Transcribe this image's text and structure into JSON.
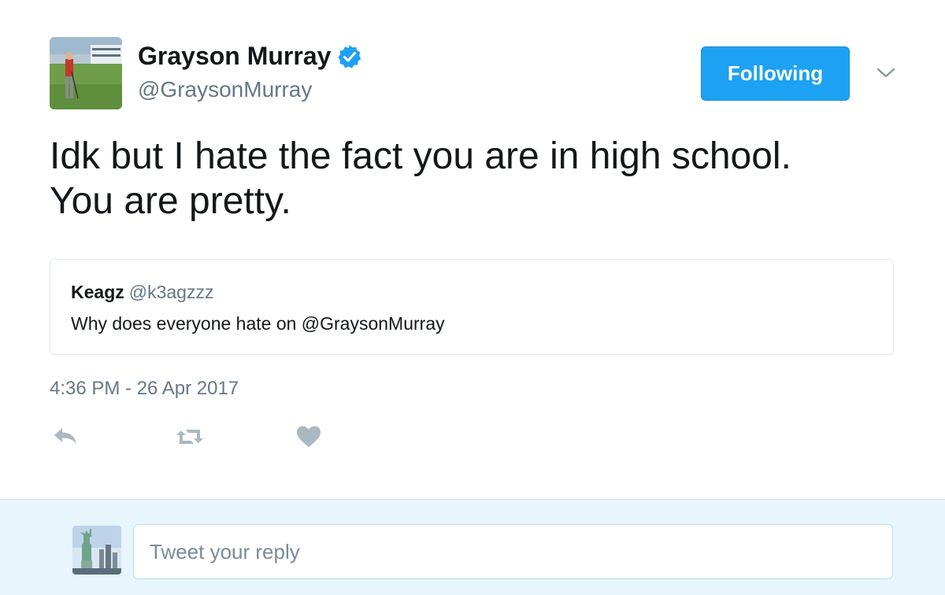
{
  "author": {
    "display_name": "Grayson Murray",
    "handle": "@GraysonMurray",
    "verified": true
  },
  "follow_button": {
    "label": "Following"
  },
  "tweet": {
    "text": "Idk but I hate the fact you are in high school.\nYou are pretty.",
    "timestamp": "4:36 PM - 26 Apr 2017"
  },
  "quoted_tweet": {
    "display_name": "Keagz",
    "handle": "@k3agzzz",
    "text": "Why does everyone hate on @GraysonMurray"
  },
  "actions": [
    {
      "icon": "reply-icon"
    },
    {
      "icon": "retweet-icon"
    },
    {
      "icon": "like-icon"
    }
  ],
  "reply_box": {
    "placeholder": "Tweet your reply"
  },
  "colors": {
    "accent": "#1da1f2",
    "text_primary": "#14171a",
    "text_secondary": "#657786",
    "icon_gray": "#aab8c2",
    "reply_bar_bg": "#e8f5fd"
  }
}
